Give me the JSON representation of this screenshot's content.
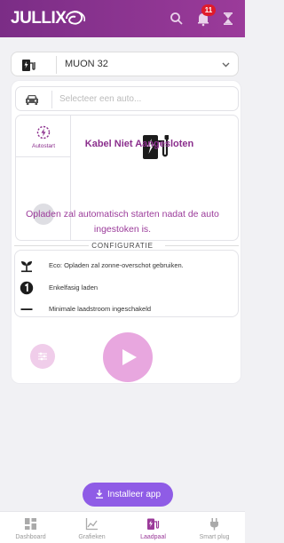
{
  "header": {
    "brand": "JULLIX",
    "notification_count": "11",
    "bg_color": "#8b2f8d"
  },
  "device": {
    "selected": "MUON 32",
    "icon": "ev-charger-icon"
  },
  "car": {
    "placeholder": "Selecteer een auto..."
  },
  "status": {
    "autostart_label": "Autostart",
    "cable_text": "Kabel Niet Aangesloten",
    "accent_color": "#8b2f8d"
  },
  "info_text": "Opladen zal automatisch starten nadat de auto ingestoken is.",
  "config": {
    "title": "CONFIGURATIE",
    "rows": [
      {
        "icon": "eco-sprout-icon",
        "text": "Eco: Opladen zal zonne-overschot gebruiken."
      },
      {
        "icon": "phase-one-icon",
        "text": "Enkelfasig laden"
      },
      {
        "icon": "minimum-current-icon",
        "text": "Minimale laadstroom ingeschakeld"
      }
    ]
  },
  "actions": {
    "settings_icon": "sliders-icon",
    "play_icon": "play-icon"
  },
  "install": {
    "label": "Installeer app"
  },
  "nav": {
    "items": [
      {
        "label": "Dashboard",
        "icon": "dashboard-icon"
      },
      {
        "label": "Grafieken",
        "icon": "chart-icon"
      },
      {
        "label": "Laadpaal",
        "icon": "charger-icon"
      },
      {
        "label": "Smart plug",
        "icon": "plug-icon"
      }
    ],
    "active": "Laadpaal"
  }
}
